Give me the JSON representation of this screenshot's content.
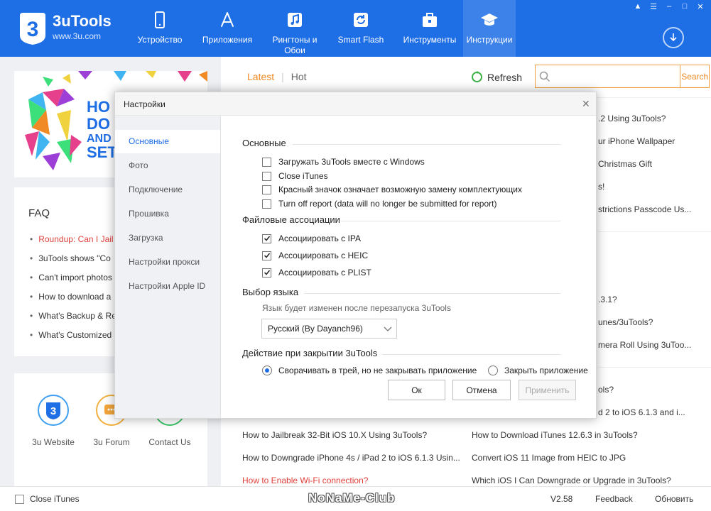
{
  "app": {
    "title": "3uTools",
    "site": "www.3u.com"
  },
  "nav": [
    {
      "label": "Устройство",
      "icon": "phone-icon"
    },
    {
      "label": "Приложения",
      "icon": "app-store-icon"
    },
    {
      "label": "Рингтоны и Обои",
      "icon": "music-icon"
    },
    {
      "label": "Smart Flash",
      "icon": "flash-icon"
    },
    {
      "label": "Инструменты",
      "icon": "toolbox-icon"
    },
    {
      "label": "Инструкции",
      "icon": "graduation-cap-icon"
    }
  ],
  "faq": {
    "title": "FAQ",
    "items": [
      "Roundup: Can I Jail",
      "3uTools shows \"Co",
      "Can't import photos",
      "How to download a",
      "What's Backup & Re",
      "What's Customized"
    ]
  },
  "links": {
    "website": "3u Website",
    "forum": "3u Forum",
    "contact": "Contact Us"
  },
  "content": {
    "tab_latest": "Latest",
    "tab_hot": "Hot",
    "refresh": "Refresh",
    "search_btn": "Search",
    "articles_right": [
      ".2 Using 3uTools?",
      "ur iPhone Wallpaper",
      "Christmas Gift",
      "s!",
      "strictions Passcode Us...",
      ".3.1?",
      "unes/3uTools?",
      "mera Roll Using 3uToo...",
      "ols?",
      "d 2 to iOS 6.1.3 and i..."
    ],
    "articles_bottom_left": [
      "How to Jailbreak 32-Bit iOS 10.X Using 3uTools?",
      "How to Downgrade iPhone 4s / iPad 2 to iOS 6.1.3 Usin...",
      "How to Enable Wi-Fi connection?"
    ],
    "articles_bottom_right": [
      "How to Download iTunes 12.6.3 in 3uTools?",
      "Convert iOS 11 Image from HEIC to JPG",
      "Which iOS I Can Downgrade or Upgrade in 3uTools?"
    ]
  },
  "status": {
    "close_itunes": "Close iTunes",
    "watermark": "NoNaMe-Club",
    "version": "V2.58",
    "feedback": "Feedback",
    "update": "Обновить"
  },
  "dialog": {
    "title": "Настройки",
    "sidebar": [
      "Основные",
      "Фото",
      "Подключение",
      "Прошивка",
      "Загрузка",
      "Настройки прокси",
      "Настройки Apple ID"
    ],
    "section_general": "Основные",
    "general_options": [
      {
        "label": "Загружать 3uTools вместе с Windows",
        "checked": false
      },
      {
        "label": "Close iTunes",
        "checked": false
      },
      {
        "label": "Красный значок означает возможную замену комплектующих",
        "checked": false
      },
      {
        "label": "Turn off report (data will no longer be submitted for report)",
        "checked": false
      }
    ],
    "section_files": "Файловые ассоциации",
    "file_options": [
      {
        "label": "Ассоциировать с IPA",
        "checked": true
      },
      {
        "label": "Ассоциировать с HEIC",
        "checked": true
      },
      {
        "label": "Ассоциировать с PLIST",
        "checked": true
      }
    ],
    "section_lang": "Выбор языка",
    "lang_note": "Язык будет изменен после перезапуска 3uTools",
    "lang_value": "Русский (By Dayanch96)",
    "section_close": "Действие при закрытии 3uTools",
    "radio_tray": "Сворачивать в трей, но не закрывать приложение",
    "radio_close": "Закрыть приложение",
    "btn_ok": "Ок",
    "btn_cancel": "Отмена",
    "btn_apply": "Применить"
  },
  "colors": {
    "brand": "#1e6ee6",
    "accent": "#f08a24",
    "link_red": "#e0413c"
  }
}
